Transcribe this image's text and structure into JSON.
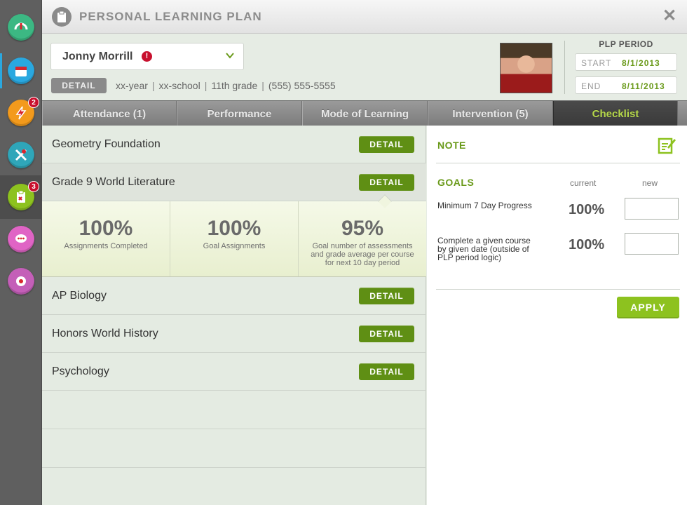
{
  "header": {
    "title": "PERSONAL LEARNING PLAN"
  },
  "sidebar": {
    "items": [
      {
        "icon": "gauge-icon",
        "color": "#3cb883"
      },
      {
        "icon": "calendar-icon",
        "color": "#2aa8e0"
      },
      {
        "icon": "lightning-icon",
        "color": "#f39a1c",
        "badge": "2"
      },
      {
        "icon": "tools-icon",
        "color": "#2fa6b9"
      },
      {
        "icon": "clipboard-icon",
        "color": "#8dc21f",
        "badge": "3"
      },
      {
        "icon": "chat-icon",
        "color": "#e064c5"
      },
      {
        "icon": "settings-icon",
        "color": "#c45fb8"
      }
    ]
  },
  "student": {
    "name": "Jonny Morrill",
    "alert": "!",
    "detail_label": "DETAIL",
    "year": "xx-year",
    "school": "xx-school",
    "grade": "11th grade",
    "phone": "(555) 555-5555"
  },
  "plp_period": {
    "title": "PLP PERIOD",
    "start_label": "START",
    "start_value": "8/1/2013",
    "end_label": "END",
    "end_value": "8/11/2013"
  },
  "tabs": [
    {
      "label": "Attendance (1)"
    },
    {
      "label": "Performance"
    },
    {
      "label": "Mode of Learning"
    },
    {
      "label": "Intervention (5)"
    },
    {
      "label": "Checklist"
    }
  ],
  "courses": [
    {
      "name": "Geometry Foundation",
      "detail": "DETAIL"
    },
    {
      "name": "Grade 9 World Literature",
      "detail": "DETAIL"
    },
    {
      "name": "AP Biology",
      "detail": "DETAIL"
    },
    {
      "name": "Honors World History",
      "detail": "DETAIL"
    },
    {
      "name": "Psychology",
      "detail": "DETAIL"
    }
  ],
  "stats": [
    {
      "value": "100%",
      "label": "Assignments Completed"
    },
    {
      "value": "100%",
      "label": "Goal Assignments"
    },
    {
      "value": "95%",
      "label": "Goal number of assessments and grade average per course for next 10 day period"
    }
  ],
  "right": {
    "note_title": "NOTE",
    "goals_title": "GOALS",
    "col_current": "current",
    "col_new": "new",
    "goals": [
      {
        "label": "Minimum 7 Day Progress",
        "current": "100%",
        "new": ""
      },
      {
        "label": "Complete a given course by given date (outside of PLP period logic)",
        "current": "100%",
        "new": ""
      }
    ],
    "apply": "APPLY"
  }
}
